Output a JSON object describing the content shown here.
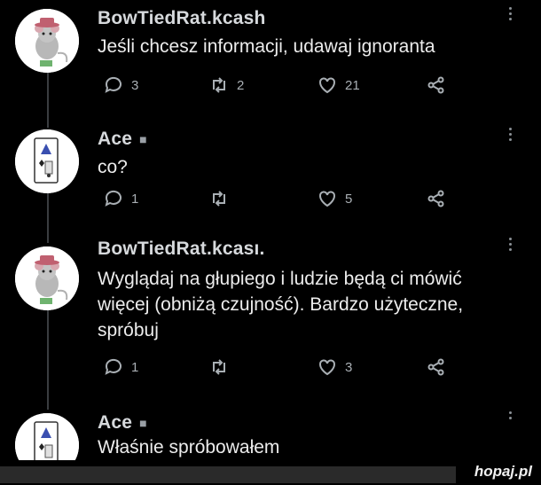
{
  "tweets": [
    {
      "username": "BowTiedRat.kcash",
      "avatar": "rat-avatar",
      "text": "Jeśli chcesz informacji, udawaj ignoranta",
      "replies": "3",
      "retweets": "2",
      "likes": "21"
    },
    {
      "username": "Ace",
      "avatar": "ace-card-avatar",
      "text": "co?",
      "replies": "1",
      "retweets": "",
      "likes": "5"
    },
    {
      "username": "BowTiedRat.kcası.",
      "avatar": "rat-avatar",
      "text_lines": [
        "Wyglądaj na głupiego i ludzie będą ci mówić",
        "więcej (obniżą czujność). Bardzo użyteczne,",
        "spróbuj"
      ],
      "replies": "1",
      "retweets": "",
      "likes": "3"
    },
    {
      "username": "Ace",
      "avatar": "ace-card-avatar",
      "text": "Właśnie spróbowałem"
    }
  ],
  "watermark": "hopaj.pl",
  "colors": {
    "background": "#000000",
    "text": "#ececec",
    "icon": "#a9afb4"
  }
}
